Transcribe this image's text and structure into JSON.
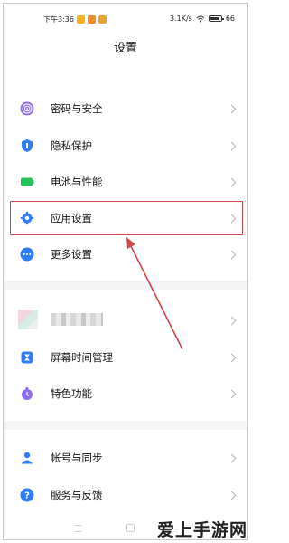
{
  "status_bar": {
    "time": "下午3:36",
    "network_speed": "3.1K/s",
    "battery": "66"
  },
  "header": {
    "title": "设置"
  },
  "group1": [
    {
      "label": "密码与安全",
      "icon": "fingerprint-icon"
    },
    {
      "label": "隐私保护",
      "icon": "shield-icon"
    },
    {
      "label": "电池与性能",
      "icon": "battery-icon"
    },
    {
      "label": "应用设置",
      "icon": "gear-icon",
      "highlighted": true
    },
    {
      "label": "更多设置",
      "icon": "more-icon"
    }
  ],
  "group2": [
    {
      "label": "",
      "icon": "blurred-account",
      "blurred": true
    },
    {
      "label": "屏幕时间管理",
      "icon": "hourglass-icon"
    },
    {
      "label": "特色功能",
      "icon": "feature-icon"
    }
  ],
  "group3": [
    {
      "label": "帐号与同步",
      "icon": "person-icon"
    },
    {
      "label": "服务与反馈",
      "icon": "help-icon"
    }
  ],
  "watermark": {
    "text": "爱上手游网"
  },
  "colors": {
    "highlight_border": "#d04848",
    "arrow": "#d04848",
    "accent_blue": "#2f7cf6",
    "accent_green": "#25c25b",
    "accent_purple": "#8f6cf2"
  }
}
